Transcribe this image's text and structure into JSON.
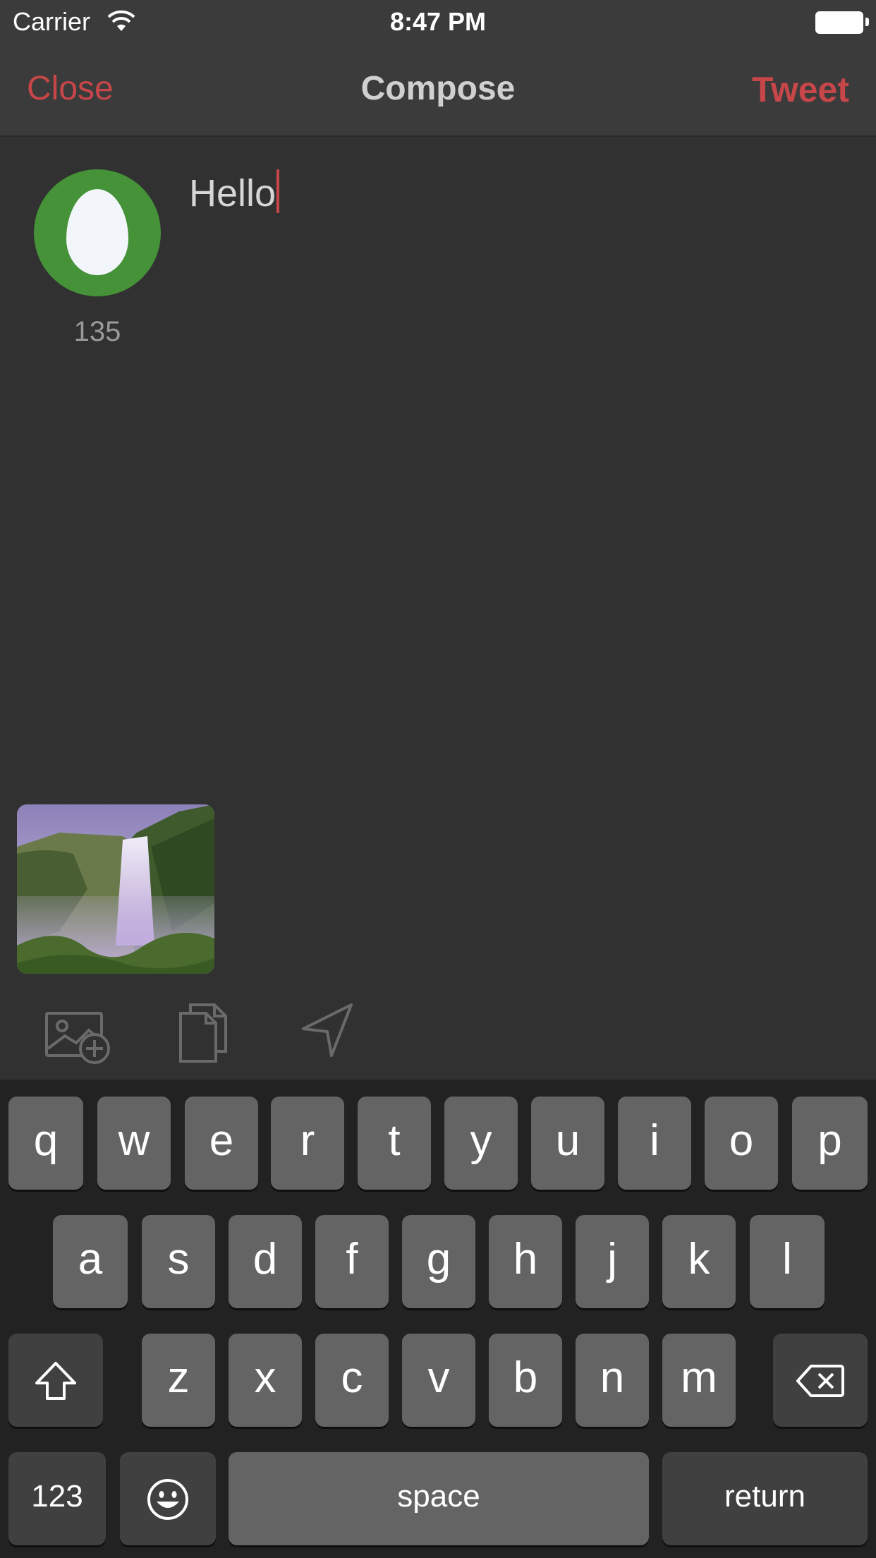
{
  "status_bar": {
    "carrier": "Carrier",
    "time": "8:47 PM"
  },
  "nav": {
    "close_label": "Close",
    "title": "Compose",
    "tweet_label": "Tweet"
  },
  "compose": {
    "text": "Hello",
    "char_count": "135"
  },
  "attachment": {
    "icon": "waterfall-photo"
  },
  "toolbar": {
    "icons": [
      "add-photo-icon",
      "drafts-icon",
      "location-icon"
    ]
  },
  "keyboard": {
    "row1": [
      "q",
      "w",
      "e",
      "r",
      "t",
      "y",
      "u",
      "i",
      "o",
      "p"
    ],
    "row2": [
      "a",
      "s",
      "d",
      "f",
      "g",
      "h",
      "j",
      "k",
      "l"
    ],
    "row3": [
      "z",
      "x",
      "c",
      "v",
      "b",
      "n",
      "m"
    ],
    "numbers_label": "123",
    "space_label": "space",
    "return_label": "return"
  },
  "colors": {
    "accent": "#c74649",
    "background": "#313131",
    "bar": "#3b3b3b",
    "key": "#646464",
    "avatar": "#459238"
  }
}
